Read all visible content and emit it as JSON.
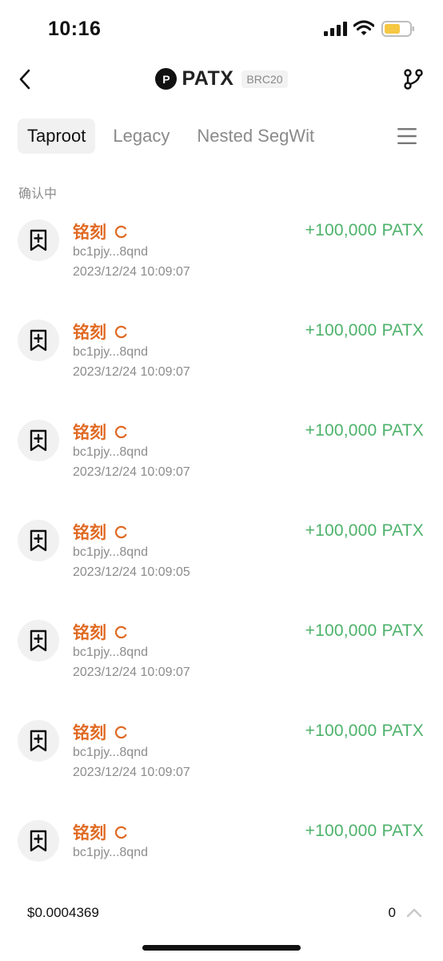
{
  "status_bar": {
    "time": "10:16",
    "battery_color": "#f5c742"
  },
  "header": {
    "logo_letter": "P",
    "token": "PATX",
    "badge": "BRC20",
    "back_icon": "chevron-left-icon",
    "branch_icon": "git-branch-icon"
  },
  "tabs": [
    {
      "label": "Taproot",
      "active": true
    },
    {
      "label": "Legacy",
      "active": false
    },
    {
      "label": "Nested SegWit",
      "active": false
    }
  ],
  "section_label": "确认中",
  "colors": {
    "accent_orange": "#e06a23",
    "amount_green": "#4db26a",
    "muted": "#8c8c8c"
  },
  "transactions": [
    {
      "title": "铭刻",
      "address": "bc1pjy...8qnd",
      "time": "2023/12/24 10:09:07",
      "amount": "+100,000 PATX",
      "status_icon": "loading-spinner-icon"
    },
    {
      "title": "铭刻",
      "address": "bc1pjy...8qnd",
      "time": "2023/12/24 10:09:07",
      "amount": "+100,000 PATX",
      "status_icon": "loading-spinner-icon"
    },
    {
      "title": "铭刻",
      "address": "bc1pjy...8qnd",
      "time": "2023/12/24 10:09:07",
      "amount": "+100,000 PATX",
      "status_icon": "loading-spinner-icon"
    },
    {
      "title": "铭刻",
      "address": "bc1pjy...8qnd",
      "time": "2023/12/24 10:09:05",
      "amount": "+100,000 PATX",
      "status_icon": "loading-spinner-icon"
    },
    {
      "title": "铭刻",
      "address": "bc1pjy...8qnd",
      "time": "2023/12/24 10:09:07",
      "amount": "+100,000 PATX",
      "status_icon": "loading-spinner-icon"
    },
    {
      "title": "铭刻",
      "address": "bc1pjy...8qnd",
      "time": "2023/12/24 10:09:07",
      "amount": "+100,000 PATX",
      "status_icon": "loading-spinner-icon"
    },
    {
      "title": "铭刻",
      "address": "bc1pjy...8qnd",
      "time": "",
      "amount": "+100,000 PATX",
      "status_icon": "loading-spinner-icon"
    }
  ],
  "bottom_bar": {
    "price": "$0.0004369",
    "count": "0",
    "collapse_icon": "chevron-up-icon"
  }
}
